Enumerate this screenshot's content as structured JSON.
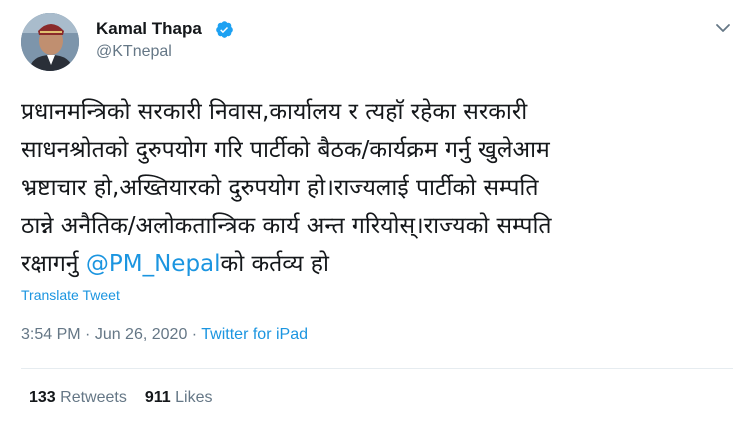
{
  "author": {
    "name": "Kamal Thapa",
    "handle": "@KTnepal"
  },
  "tweet": {
    "lines": [
      "प्रधानमन्त्रिको सरकारी निवास,कार्यालय र त्यहाॅ रहेका सरकारी",
      "साधनश्रोतको दुरुपयोग गरि पार्टीको बैठक/कार्यक्रम गर्नु खुलेआम",
      "भ्रष्टाचार हो,अख्तियारको दुरुपयोग हो।राज्यलाई पार्टीको सम्पति",
      "ठान्ने अनैतिक/अलोकतान्त्रिक कार्य अन्त गरियोस्।राज्यको सम्पति"
    ],
    "last_line_prefix": "रक्षागर्नु ",
    "mention": "@PM_Nepal",
    "last_line_suffix": "को कर्तव्य हो"
  },
  "translate_label": "Translate Tweet",
  "meta": {
    "time": "3:54 PM",
    "separator": " · ",
    "date": "Jun 26, 2020",
    "source": "Twitter for iPad"
  },
  "stats": {
    "retweets_count": "133",
    "retweets_label": "Retweets",
    "likes_count": "911",
    "likes_label": "Likes"
  },
  "colors": {
    "link": "#1b95e0",
    "muted": "#657786",
    "text": "#14171a",
    "verified": "#1da1f2"
  },
  "icons": {
    "verified": "verified-badge-icon",
    "caret": "chevron-down-icon"
  }
}
